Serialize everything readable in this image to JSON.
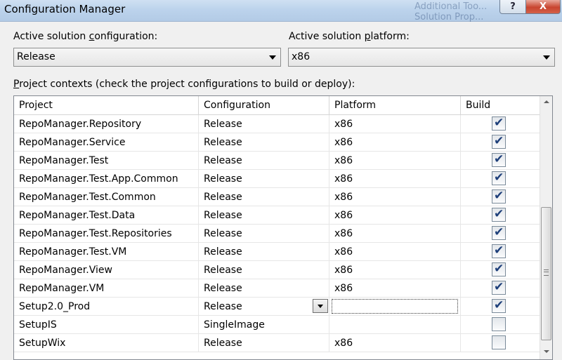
{
  "window": {
    "title": "Configuration Manager",
    "background_menu": [
      "Additional Too...",
      "Solution Prop..."
    ],
    "help_label": "?",
    "close_label": "X"
  },
  "solution": {
    "configuration_label_pre": "Active solution ",
    "configuration_label_u": "c",
    "configuration_label_post": "onfiguration:",
    "configuration_value": "Release",
    "platform_label_pre": "Active solution ",
    "platform_label_u": "p",
    "platform_label_post": "latform:",
    "platform_value": "x86"
  },
  "project_contexts": {
    "label_u": "P",
    "label_post": "roject contexts (check the project configurations to build or deploy):",
    "columns": [
      "Project",
      "Configuration",
      "Platform",
      "Build"
    ],
    "rows": [
      {
        "project": "RepoManager.Repository",
        "configuration": "Release",
        "platform": "x86",
        "build": true
      },
      {
        "project": "RepoManager.Service",
        "configuration": "Release",
        "platform": "x86",
        "build": true
      },
      {
        "project": "RepoManager.Test",
        "configuration": "Release",
        "platform": "x86",
        "build": true
      },
      {
        "project": "RepoManager.Test.App.Common",
        "configuration": "Release",
        "platform": "x86",
        "build": true
      },
      {
        "project": "RepoManager.Test.Common",
        "configuration": "Release",
        "platform": "x86",
        "build": true
      },
      {
        "project": "RepoManager.Test.Data",
        "configuration": "Release",
        "platform": "x86",
        "build": true
      },
      {
        "project": "RepoManager.Test.Repositories",
        "configuration": "Release",
        "platform": "x86",
        "build": true
      },
      {
        "project": "RepoManager.Test.VM",
        "configuration": "Release",
        "platform": "x86",
        "build": true
      },
      {
        "project": "RepoManager.View",
        "configuration": "Release",
        "platform": "x86",
        "build": true
      },
      {
        "project": "RepoManager.VM",
        "configuration": "Release",
        "platform": "x86",
        "build": true
      },
      {
        "project": "Setup2.0_Prod",
        "configuration": "Release",
        "platform": "",
        "build": true
      },
      {
        "project": "SetupIS",
        "configuration": "SingleImage",
        "platform": "",
        "build": false
      },
      {
        "project": "SetupWix",
        "configuration": "Release",
        "platform": "x86",
        "build": false
      }
    ]
  },
  "icons": {
    "check": "✔",
    "dropdown": "chevron-down-icon"
  }
}
